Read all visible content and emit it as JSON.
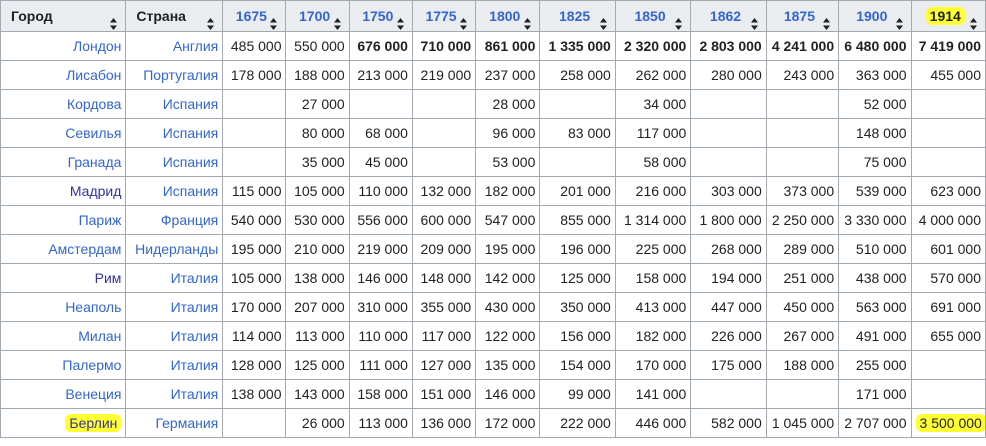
{
  "headers": [
    {
      "label": "Город",
      "link": false,
      "highlight": false
    },
    {
      "label": "Страна",
      "link": false,
      "highlight": false
    },
    {
      "label": "1675",
      "link": true,
      "highlight": false
    },
    {
      "label": "1700",
      "link": true,
      "highlight": false
    },
    {
      "label": "1750",
      "link": true,
      "highlight": false
    },
    {
      "label": "1775",
      "link": true,
      "highlight": false
    },
    {
      "label": "1800",
      "link": true,
      "highlight": false
    },
    {
      "label": "1825",
      "link": true,
      "highlight": false
    },
    {
      "label": "1850",
      "link": true,
      "highlight": false
    },
    {
      "label": "1862",
      "link": true,
      "highlight": false
    },
    {
      "label": "1875",
      "link": true,
      "highlight": false
    },
    {
      "label": "1900",
      "link": true,
      "highlight": false
    },
    {
      "label": "1914",
      "link": false,
      "highlight": true
    }
  ],
  "rows": [
    {
      "city": "Лондон",
      "country": "Англия",
      "city_visited": false,
      "city_highlight": false,
      "values": [
        "485 000",
        "550 000",
        "676 000",
        "710 000",
        "861 000",
        "1 335 000",
        "2 320 000",
        "2 803 000",
        "4 241 000",
        "6 480 000",
        "7 419 000"
      ],
      "bold": [
        false,
        false,
        true,
        true,
        true,
        true,
        true,
        true,
        true,
        true,
        true
      ],
      "value_highlight": [
        false,
        false,
        false,
        false,
        false,
        false,
        false,
        false,
        false,
        false,
        false
      ]
    },
    {
      "city": "Лисабон",
      "country": "Португалия",
      "city_visited": false,
      "city_highlight": false,
      "values": [
        "178 000",
        "188 000",
        "213 000",
        "219 000",
        "237 000",
        "258 000",
        "262 000",
        "280 000",
        "243 000",
        "363 000",
        "455 000"
      ],
      "bold": [
        false,
        false,
        false,
        false,
        false,
        false,
        false,
        false,
        false,
        false,
        false
      ],
      "value_highlight": [
        false,
        false,
        false,
        false,
        false,
        false,
        false,
        false,
        false,
        false,
        false
      ]
    },
    {
      "city": "Кордова",
      "country": "Испания",
      "city_visited": false,
      "city_highlight": false,
      "values": [
        "",
        "27 000",
        "",
        "",
        "28 000",
        "",
        "34 000",
        "",
        "",
        "52 000",
        ""
      ],
      "bold": [
        false,
        false,
        false,
        false,
        false,
        false,
        false,
        false,
        false,
        false,
        false
      ],
      "value_highlight": [
        false,
        false,
        false,
        false,
        false,
        false,
        false,
        false,
        false,
        false,
        false
      ]
    },
    {
      "city": "Севилья",
      "country": "Испания",
      "city_visited": false,
      "city_highlight": false,
      "values": [
        "",
        "80 000",
        "68 000",
        "",
        "96 000",
        "83 000",
        "117 000",
        "",
        "",
        "148 000",
        ""
      ],
      "bold": [
        false,
        false,
        false,
        false,
        false,
        false,
        false,
        false,
        false,
        false,
        false
      ],
      "value_highlight": [
        false,
        false,
        false,
        false,
        false,
        false,
        false,
        false,
        false,
        false,
        false
      ]
    },
    {
      "city": "Гранада",
      "country": "Испания",
      "city_visited": false,
      "city_highlight": false,
      "values": [
        "",
        "35 000",
        "45 000",
        "",
        "53 000",
        "",
        "58 000",
        "",
        "",
        "75 000",
        ""
      ],
      "bold": [
        false,
        false,
        false,
        false,
        false,
        false,
        false,
        false,
        false,
        false,
        false
      ],
      "value_highlight": [
        false,
        false,
        false,
        false,
        false,
        false,
        false,
        false,
        false,
        false,
        false
      ]
    },
    {
      "city": "Мадрид",
      "country": "Испания",
      "city_visited": true,
      "city_highlight": false,
      "values": [
        "115 000",
        "105 000",
        "110 000",
        "132 000",
        "182 000",
        "201 000",
        "216 000",
        "303 000",
        "373 000",
        "539 000",
        "623 000"
      ],
      "bold": [
        false,
        false,
        false,
        false,
        false,
        false,
        false,
        false,
        false,
        false,
        false
      ],
      "value_highlight": [
        false,
        false,
        false,
        false,
        false,
        false,
        false,
        false,
        false,
        false,
        false
      ]
    },
    {
      "city": "Париж",
      "country": "Франция",
      "city_visited": false,
      "city_highlight": false,
      "values": [
        "540 000",
        "530 000",
        "556 000",
        "600 000",
        "547 000",
        "855 000",
        "1 314 000",
        "1 800 000",
        "2 250 000",
        "3 330 000",
        "4 000 000"
      ],
      "bold": [
        false,
        false,
        false,
        false,
        false,
        false,
        false,
        false,
        false,
        false,
        false
      ],
      "value_highlight": [
        false,
        false,
        false,
        false,
        false,
        false,
        false,
        false,
        false,
        false,
        false
      ]
    },
    {
      "city": "Амстердам",
      "country": "Нидерланды",
      "city_visited": false,
      "city_highlight": false,
      "values": [
        "195 000",
        "210 000",
        "219 000",
        "209 000",
        "195 000",
        "196 000",
        "225 000",
        "268 000",
        "289 000",
        "510 000",
        "601 000"
      ],
      "bold": [
        false,
        false,
        false,
        false,
        false,
        false,
        false,
        false,
        false,
        false,
        false
      ],
      "value_highlight": [
        false,
        false,
        false,
        false,
        false,
        false,
        false,
        false,
        false,
        false,
        false
      ]
    },
    {
      "city": "Рим",
      "country": "Италия",
      "city_visited": true,
      "city_highlight": false,
      "values": [
        "105 000",
        "138 000",
        "146 000",
        "148 000",
        "142 000",
        "125 000",
        "158 000",
        "194 000",
        "251 000",
        "438 000",
        "570 000"
      ],
      "bold": [
        false,
        false,
        false,
        false,
        false,
        false,
        false,
        false,
        false,
        false,
        false
      ],
      "value_highlight": [
        false,
        false,
        false,
        false,
        false,
        false,
        false,
        false,
        false,
        false,
        false
      ]
    },
    {
      "city": "Неаполь",
      "country": "Италия",
      "city_visited": false,
      "city_highlight": false,
      "values": [
        "170 000",
        "207 000",
        "310 000",
        "355 000",
        "430 000",
        "350 000",
        "413 000",
        "447 000",
        "450 000",
        "563 000",
        "691 000"
      ],
      "bold": [
        false,
        false,
        false,
        false,
        false,
        false,
        false,
        false,
        false,
        false,
        false
      ],
      "value_highlight": [
        false,
        false,
        false,
        false,
        false,
        false,
        false,
        false,
        false,
        false,
        false
      ]
    },
    {
      "city": "Милан",
      "country": "Италия",
      "city_visited": false,
      "city_highlight": false,
      "values": [
        "114 000",
        "113 000",
        "110 000",
        "117 000",
        "122 000",
        "156 000",
        "182 000",
        "226 000",
        "267 000",
        "491 000",
        "655 000"
      ],
      "bold": [
        false,
        false,
        false,
        false,
        false,
        false,
        false,
        false,
        false,
        false,
        false
      ],
      "value_highlight": [
        false,
        false,
        false,
        false,
        false,
        false,
        false,
        false,
        false,
        false,
        false
      ]
    },
    {
      "city": "Палермо",
      "country": "Италия",
      "city_visited": false,
      "city_highlight": false,
      "values": [
        "128 000",
        "125 000",
        "111 000",
        "127 000",
        "135 000",
        "154 000",
        "170 000",
        "175 000",
        "188 000",
        "255 000",
        ""
      ],
      "bold": [
        false,
        false,
        false,
        false,
        false,
        false,
        false,
        false,
        false,
        false,
        false
      ],
      "value_highlight": [
        false,
        false,
        false,
        false,
        false,
        false,
        false,
        false,
        false,
        false,
        false
      ]
    },
    {
      "city": "Венеция",
      "country": "Италия",
      "city_visited": false,
      "city_highlight": false,
      "values": [
        "138 000",
        "143 000",
        "158 000",
        "151 000",
        "146 000",
        "99 000",
        "141 000",
        "",
        "",
        "171 000",
        ""
      ],
      "bold": [
        false,
        false,
        false,
        false,
        false,
        false,
        false,
        false,
        false,
        false,
        false
      ],
      "value_highlight": [
        false,
        false,
        false,
        false,
        false,
        false,
        false,
        false,
        false,
        false,
        false
      ]
    },
    {
      "city": "Берлин",
      "country": "Германия",
      "city_visited": true,
      "city_highlight": true,
      "values": [
        "",
        "26 000",
        "113 000",
        "136 000",
        "172 000",
        "222 000",
        "446 000",
        "582 000",
        "1 045 000",
        "2 707 000",
        "3 500 000"
      ],
      "bold": [
        false,
        false,
        false,
        false,
        false,
        false,
        false,
        false,
        false,
        false,
        false
      ],
      "value_highlight": [
        false,
        false,
        false,
        false,
        false,
        false,
        false,
        false,
        false,
        false,
        true
      ]
    }
  ],
  "colors": {
    "link": "#3366cc",
    "visited": "#333399",
    "header_bg": "#eaecf0",
    "border": "#a2a9b1",
    "highlight": "#ffff33"
  },
  "icons": {
    "sort": "sort-both-arrows-icon"
  }
}
